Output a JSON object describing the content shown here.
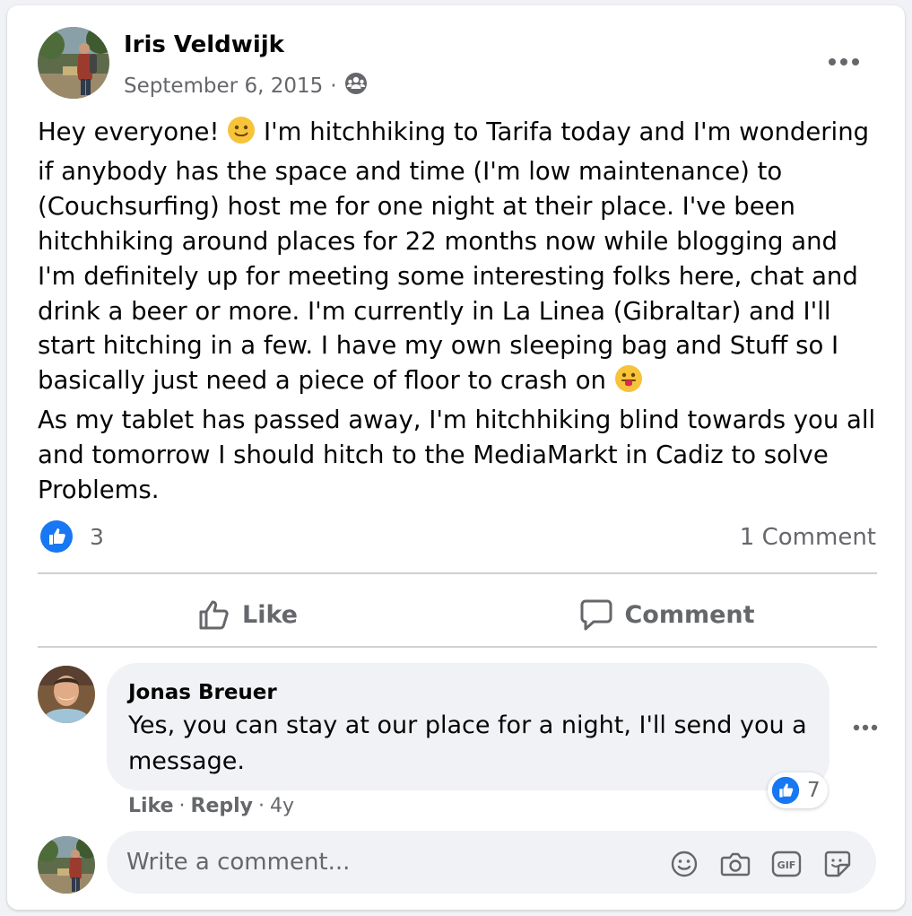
{
  "post": {
    "author": "Iris Veldwijk",
    "date": "September 6, 2015",
    "dot": "·",
    "audience_icon": "group-icon",
    "more_icon": "more-horizontal-icon",
    "text": {
      "line1_before": "Hey everyone! ",
      "emoji_smile": "slightly-smiling-face-emoji",
      "line1_after": " I'm hitchhiking to Tarifa today and I'm wondering if anybody has the space and time (I'm low maintenance) to (Couchsurfing) host me for one night at their place. I've been hitchhiking around places for 22 months now while blogging and I'm definitely up for meeting some interesting folks here, chat and drink a beer or more. I'm currently in La Linea (Gibraltar) and I'll start hitching in a few. I have my own sleeping bag and Stuff so I basically just need a piece of floor to crash on ",
      "emoji_tongue": "face-with-tongue-emoji",
      "paragraph2": "As my tablet has passed away, I'm hitchhiking blind towards you all and tomorrow I should hitch to the MediaMarkt in Cadiz to solve Problems."
    },
    "reaction_count": "3",
    "comment_count": "1 Comment"
  },
  "actions": {
    "like_label": "Like",
    "comment_label": "Comment"
  },
  "comment": {
    "author": "Jonas Breuer",
    "text": "Yes, you can stay at our place for a night, I'll send you a message.",
    "reaction_count": "7",
    "like_label": "Like",
    "reply_label": "Reply",
    "age": "4y",
    "dot": "·"
  },
  "composer": {
    "placeholder": "Write a comment...",
    "icons": [
      "emoji-icon",
      "camera-icon",
      "gif-icon",
      "sticker-icon"
    ]
  },
  "colors": {
    "brand_blue": "#1877f2",
    "text_primary": "#050505",
    "text_secondary": "#65676b",
    "bubble_bg": "#f0f2f5",
    "divider": "#ced0d4"
  }
}
